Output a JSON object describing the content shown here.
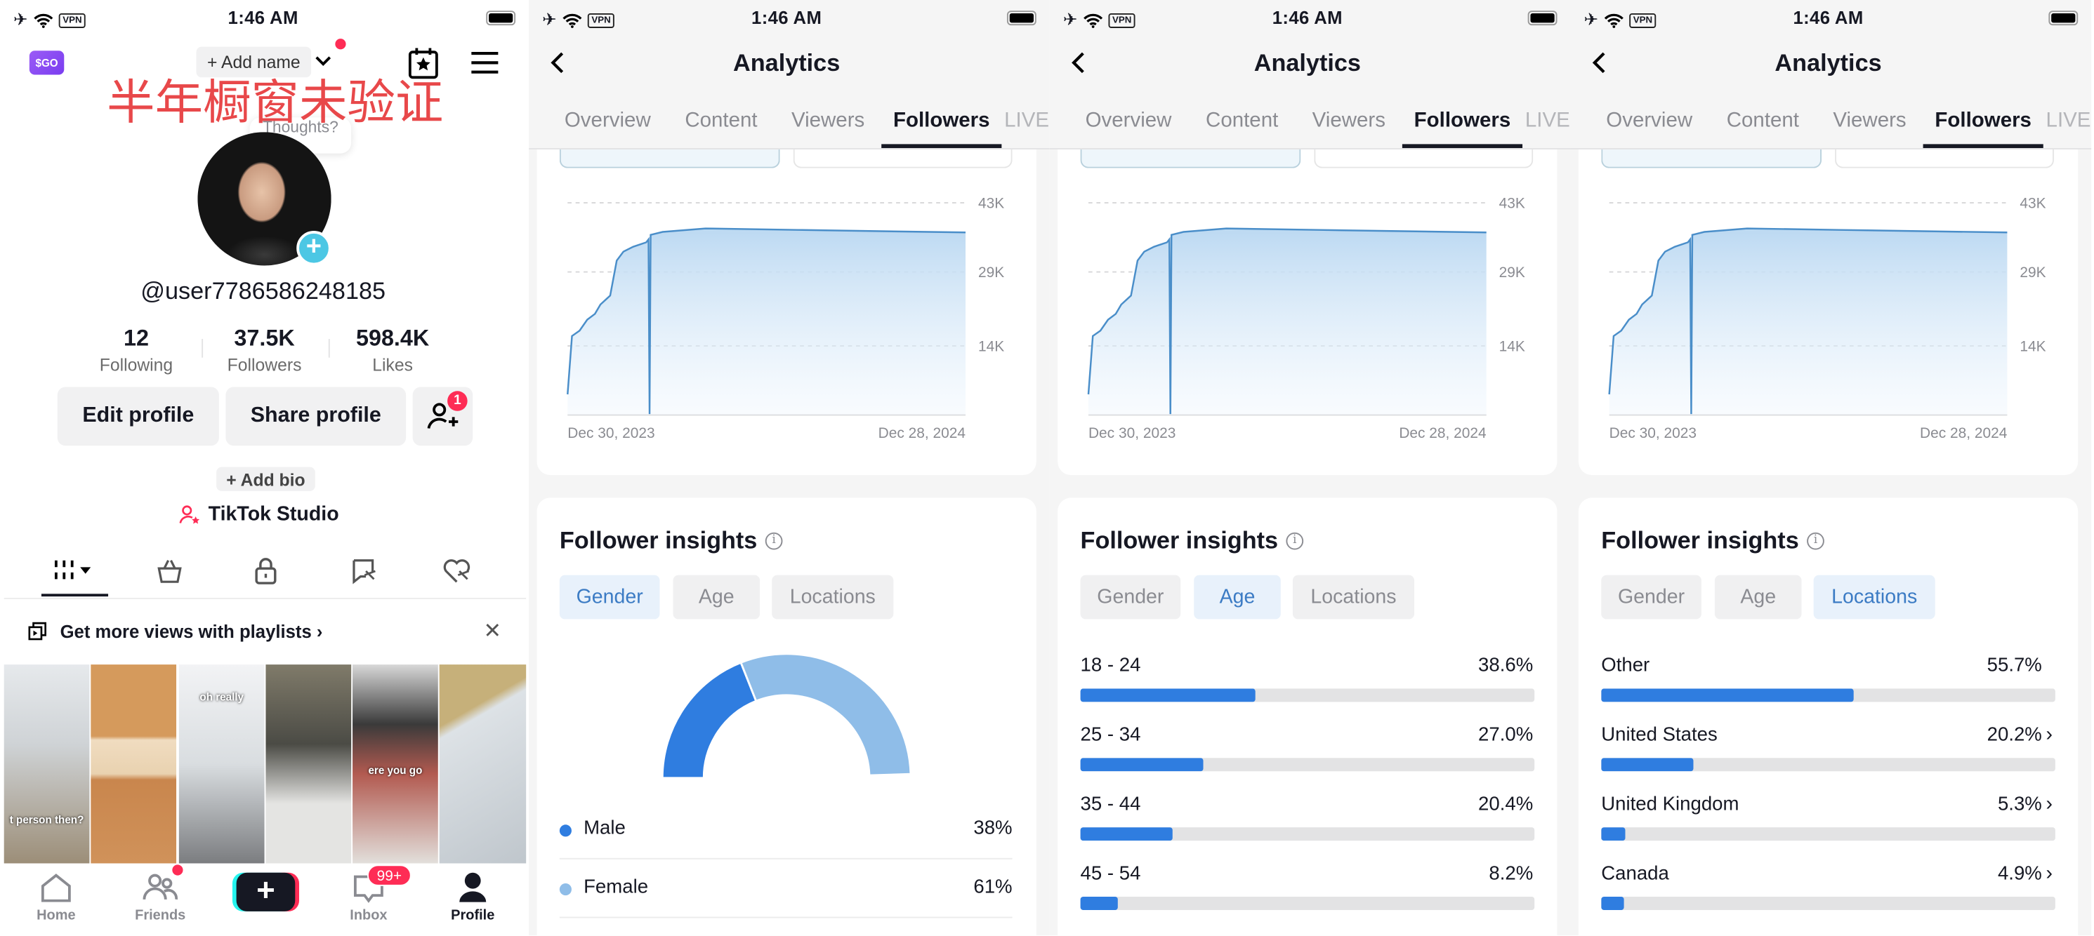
{
  "status_bar": {
    "time": "1:46 AM",
    "vpn": "VPN"
  },
  "profile": {
    "logo_text": "$GO",
    "add_name": "+ Add name",
    "overlay_text": "半年橱窗未验证",
    "thoughts": "Thoughts?",
    "username": "@user7786586248185",
    "stats": [
      {
        "value": "12",
        "label": "Following"
      },
      {
        "value": "37.5K",
        "label": "Followers"
      },
      {
        "value": "598.4K",
        "label": "Likes"
      }
    ],
    "edit_profile": "Edit profile",
    "share_profile": "Share profile",
    "friend_request_badge": "1",
    "add_bio": "+ Add bio",
    "studio": "TikTok Studio",
    "content_tabs": [
      "videos-grid-icon",
      "shop-bag-icon",
      "lock-icon",
      "reposts-icon",
      "liked-icon"
    ],
    "playlist_banner": "Get more views with playlists",
    "thumbnails": [
      {
        "caption": "t person then?"
      },
      {
        "caption": ""
      },
      {
        "caption": "oh really"
      },
      {
        "caption": ""
      },
      {
        "caption": "ere you go"
      },
      {
        "caption": ""
      }
    ],
    "nav": [
      {
        "label": "Home",
        "icon": "home-icon"
      },
      {
        "label": "Friends",
        "icon": "friends-icon"
      },
      {
        "label": "",
        "icon": "create-plus-icon"
      },
      {
        "label": "Inbox",
        "icon": "inbox-icon"
      },
      {
        "label": "Profile",
        "icon": "profile-icon"
      }
    ],
    "inbox_badge": "99+",
    "colors": {
      "badge_red": "#fe2c55",
      "overlay_red": "#e8484a",
      "avatar_plus": "#4cc7e4"
    }
  },
  "analytics": {
    "title": "Analytics",
    "tabs": [
      "Overview",
      "Content",
      "Viewers",
      "Followers",
      "LIVE"
    ],
    "active_tab": "Followers",
    "insights_title": "Follower insights",
    "chips": [
      "Gender",
      "Age",
      "Locations"
    ],
    "panel_active_chips": [
      "Gender",
      "Age",
      "Locations"
    ],
    "colors": {
      "accent": "#2f7de0",
      "light_accent": "#8fbde8",
      "line": "#4a8ec9"
    }
  },
  "chart_data": [
    {
      "type": "area",
      "x_start": "2023-12-30",
      "x_end": "2024-12-28",
      "x_tick_labels": [
        "Dec 30, 2023",
        "Dec 28, 2024"
      ],
      "y_tick_labels": [
        "43K",
        "29K",
        "14K"
      ],
      "y_ticks": [
        43000,
        29000,
        14000
      ],
      "ylim": [
        0,
        43000
      ],
      "grid": true,
      "points": [
        {
          "x": "2023-12-30",
          "y": 4200
        },
        {
          "x": "2024-01-03",
          "y": 16000
        },
        {
          "x": "2024-01-10",
          "y": 17100
        },
        {
          "x": "2024-01-17",
          "y": 19300
        },
        {
          "x": "2024-01-24",
          "y": 20500
        },
        {
          "x": "2024-01-29",
          "y": 22400
        },
        {
          "x": "2024-02-04",
          "y": 23600
        },
        {
          "x": "2024-02-07",
          "y": 24200
        },
        {
          "x": "2024-02-13",
          "y": 31300
        },
        {
          "x": "2024-02-19",
          "y": 33100
        },
        {
          "x": "2024-02-28",
          "y": 34100
        },
        {
          "x": "2024-03-11",
          "y": 35000
        },
        {
          "x": "2024-03-13",
          "y": 35600
        },
        {
          "x": "2024-03-14",
          "y": 200
        },
        {
          "x": "2024-03-15",
          "y": 36500
        },
        {
          "x": "2024-03-26",
          "y": 37100
        },
        {
          "x": "2024-05-04",
          "y": 37800
        },
        {
          "x": "2024-07-28",
          "y": 37500
        },
        {
          "x": "2024-12-28",
          "y": 37000
        }
      ]
    },
    {
      "type": "pie",
      "variant": "half-donut",
      "categories": [
        "Male",
        "Female"
      ],
      "values": [
        38,
        61
      ],
      "labels": [
        "38%",
        "61%"
      ],
      "colors": [
        "#2f7de0",
        "#8fbde8"
      ]
    },
    {
      "type": "bar",
      "orientation": "horizontal",
      "categories": [
        "18 - 24",
        "25 - 34",
        "35 - 44",
        "45 - 54"
      ],
      "values": [
        38.6,
        27.0,
        20.4,
        8.2
      ],
      "labels": [
        "38.6%",
        "27.0%",
        "20.4%",
        "8.2%"
      ],
      "xlim": [
        0,
        100
      ]
    },
    {
      "type": "bar",
      "orientation": "horizontal",
      "categories": [
        "Other",
        "United States",
        "United Kingdom",
        "Canada"
      ],
      "values": [
        55.7,
        20.2,
        5.3,
        4.9
      ],
      "labels": [
        "55.7%",
        "20.2%",
        "5.3%",
        "4.9%"
      ],
      "chevrons": [
        false,
        true,
        true,
        true
      ],
      "xlim": [
        0,
        100
      ]
    }
  ]
}
